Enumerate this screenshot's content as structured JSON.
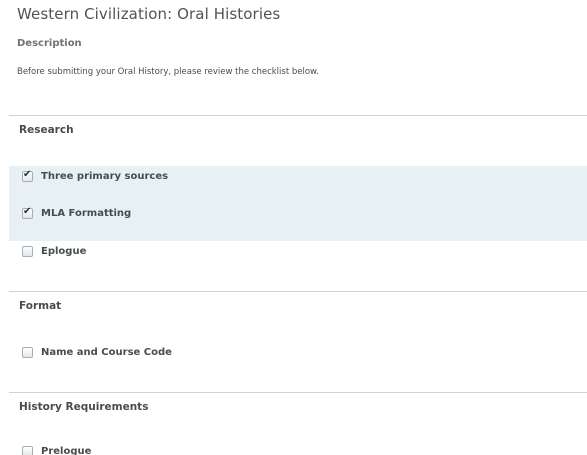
{
  "header": {
    "title": "Western Civilization: Oral Histories",
    "description_label": "Description",
    "description_text": "Before submitting your Oral History, please review the checklist below."
  },
  "sections": [
    {
      "heading": "Research",
      "items": [
        {
          "label": "Three primary sources",
          "checked": true
        },
        {
          "label": "MLA Formatting",
          "checked": true
        },
        {
          "label": "Eplogue",
          "checked": false
        }
      ]
    },
    {
      "heading": "Format",
      "items": [
        {
          "label": "Name and Course Code",
          "checked": false
        }
      ]
    },
    {
      "heading": "History Requirements",
      "items": [
        {
          "label": "Prelogue",
          "checked": false
        }
      ]
    }
  ],
  "icons": {
    "checked": "checkmark-icon"
  },
  "colors": {
    "highlight": "#e7f1f5",
    "text": "#494c4e",
    "rule": "#cfd3d5"
  }
}
